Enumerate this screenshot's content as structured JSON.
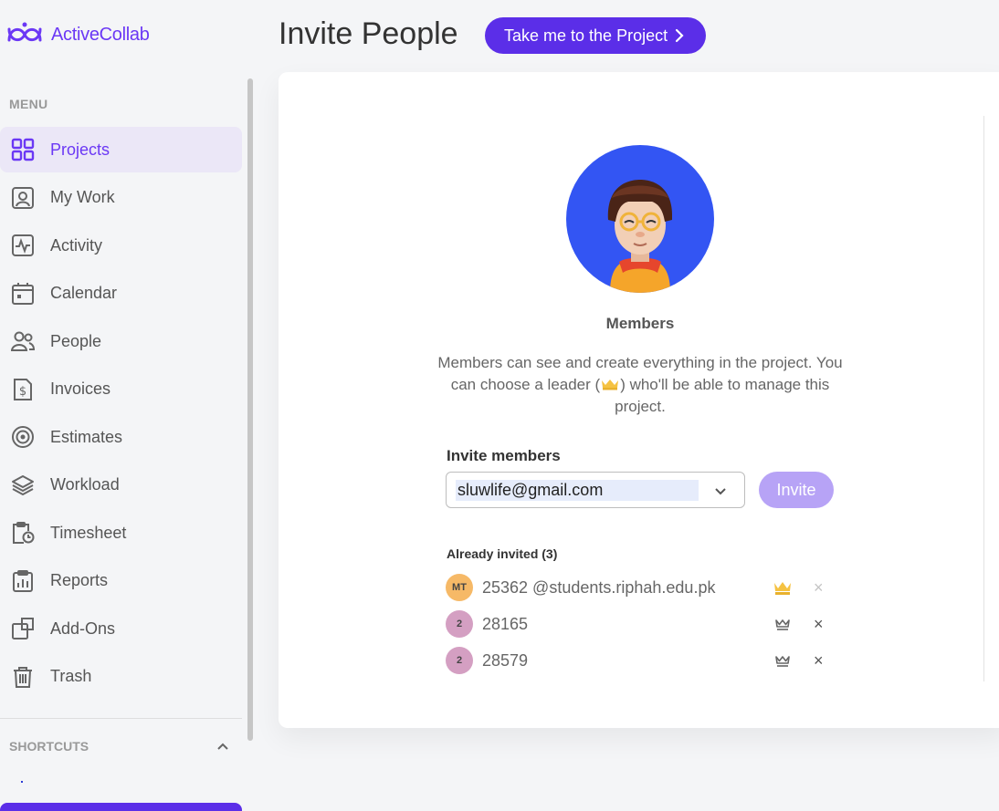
{
  "brand": {
    "name": "ActiveCollab",
    "color": "#6b38f5"
  },
  "sidebar": {
    "menu_label": "MENU",
    "items": [
      {
        "label": "Projects",
        "icon": "grid-icon",
        "active": true
      },
      {
        "label": "My Work",
        "icon": "user-badge-icon"
      },
      {
        "label": "Activity",
        "icon": "activity-icon"
      },
      {
        "label": "Calendar",
        "icon": "calendar-icon"
      },
      {
        "label": "People",
        "icon": "people-icon"
      },
      {
        "label": "Invoices",
        "icon": "invoice-icon"
      },
      {
        "label": "Estimates",
        "icon": "target-icon"
      },
      {
        "label": "Workload",
        "icon": "layers-icon"
      },
      {
        "label": "Timesheet",
        "icon": "timesheet-icon"
      },
      {
        "label": "Reports",
        "icon": "reports-icon"
      },
      {
        "label": "Add-Ons",
        "icon": "addons-icon"
      },
      {
        "label": "Trash",
        "icon": "trash-icon"
      }
    ],
    "shortcuts_label": "SHORTCUTS"
  },
  "header": {
    "title": "Invite People",
    "project_button": "Take me to the Project"
  },
  "card": {
    "role_title": "Members",
    "description_part1": "Members can see and create everything in the project. You can choose a leader (",
    "description_part2": ") who'll be able to manage this project.",
    "invite_label": "Invite members",
    "invite_value": "sluwlife@gmail.com",
    "invite_button": "Invite",
    "already_invited_label": "Already invited",
    "already_invited_count": "(3)",
    "invited": [
      {
        "initials": "MT",
        "name": "25362 @students.riphah.edu.pk",
        "avatar_color": "#f6b967",
        "leader": true
      },
      {
        "initials": "2",
        "name": "28165",
        "avatar_color": "#d49fc2",
        "leader": false
      },
      {
        "initials": "2",
        "name": "28579",
        "avatar_color": "#d49fc2",
        "leader": false
      }
    ]
  },
  "colors": {
    "accent": "#5b2ee8",
    "invite_disabled": "#b7a3f6",
    "avatar_bg": "#3355f3",
    "crown_active": "#f5c242"
  }
}
